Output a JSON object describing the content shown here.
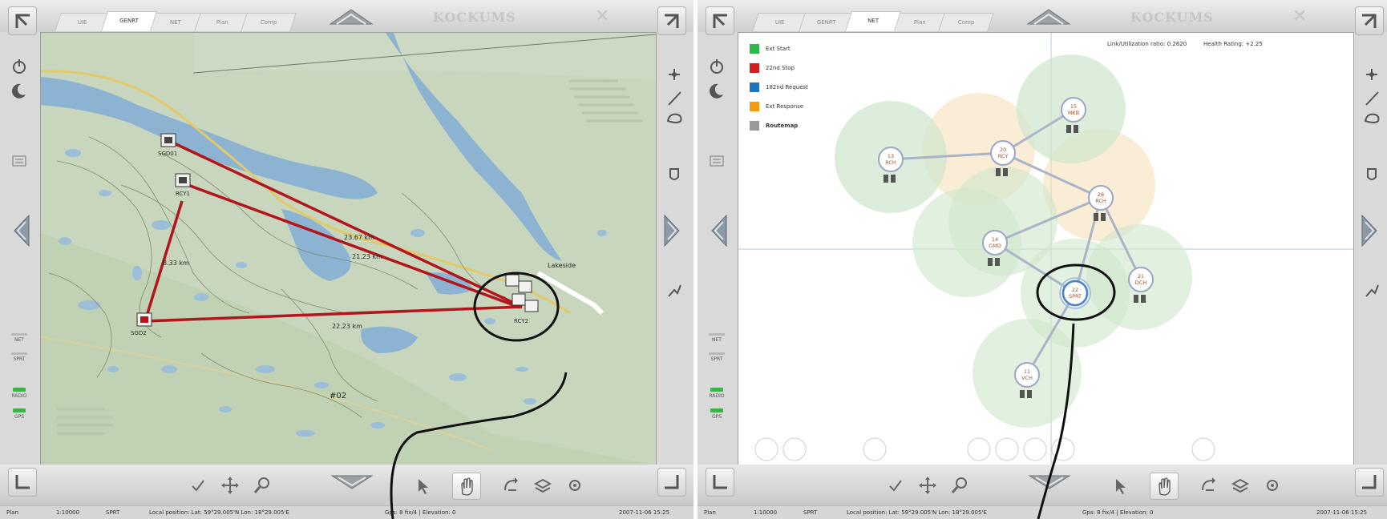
{
  "left_window": {
    "tabs": [
      {
        "label": "UIE",
        "active": false
      },
      {
        "label": "GENRT",
        "active": true
      },
      {
        "label": "NET",
        "active": false
      },
      {
        "label": "Plan",
        "active": false
      },
      {
        "label": "Comp",
        "active": false
      }
    ],
    "logo": "KOCKUMS",
    "side_labels": [
      "NET",
      "SPRT",
      "RADIO",
      "GPS"
    ],
    "map": {
      "units": [
        {
          "id": "SGD1",
          "label": "SGD01"
        },
        {
          "id": "RCY1",
          "label": "RCY1"
        },
        {
          "id": "SGD2",
          "label": "SGD2"
        },
        {
          "id": "CLUSTER",
          "label": "RCY2"
        }
      ],
      "distances": [
        "23.67 km",
        "21.23 km",
        "8.33 km",
        "22.23 km"
      ],
      "labels": [
        "Lakeside",
        "#02"
      ]
    },
    "status": {
      "mode": "Plan",
      "scale": "1:10000",
      "unit": "SPRT",
      "position": "Local position: Lat: 59°29.005'N Lon: 18°29.005'E",
      "gps": "Gps: 8 fix/4 | Elevation: 0",
      "datetime": "2007-11-06 15:25"
    }
  },
  "right_window": {
    "tabs": [
      {
        "label": "UIE",
        "active": false
      },
      {
        "label": "GENRT",
        "active": false
      },
      {
        "label": "NET",
        "active": true
      },
      {
        "label": "Plan",
        "active": false
      },
      {
        "label": "Comp",
        "active": false
      }
    ],
    "logo": "KOCKUMS",
    "side_labels": [
      "NET",
      "SPRT",
      "RADIO",
      "GPS"
    ],
    "legend": [
      {
        "label": "Ext Start",
        "color": "#2db84a"
      },
      {
        "label": "22nd Stop",
        "color": "#d11f1f"
      },
      {
        "label": "182nd Request",
        "color": "#1e73be"
      },
      {
        "label": "Ext Response",
        "color": "#f39c12"
      },
      {
        "label": "Routemap",
        "color": "#999999"
      }
    ],
    "info": {
      "utilization": "Link/Utilization ratio: 0.2620",
      "health": "Health Rating: +2.25"
    },
    "nodes": [
      {
        "id": "n15",
        "num": "15",
        "name": "MKB"
      },
      {
        "id": "n13",
        "num": "13",
        "name": "RCH"
      },
      {
        "id": "n20",
        "num": "20",
        "name": "RCY"
      },
      {
        "id": "n28",
        "num": "28",
        "name": "RCH"
      },
      {
        "id": "n14",
        "num": "14",
        "name": "GMD"
      },
      {
        "id": "n22",
        "num": "22",
        "name": "SPRT"
      },
      {
        "id": "n21",
        "num": "21",
        "name": "DCH"
      },
      {
        "id": "n11",
        "num": "11",
        "name": "VCH"
      }
    ],
    "status": {
      "mode": "Plan",
      "scale": "1:10000",
      "unit": "SPRT",
      "position": "Local position: Lat: 59°29.005'N Lon: 18°29.005'E",
      "gps": "Gps: 8 fix/4 | Elevation: 0",
      "datetime": "2007-11-06 15:25"
    }
  }
}
